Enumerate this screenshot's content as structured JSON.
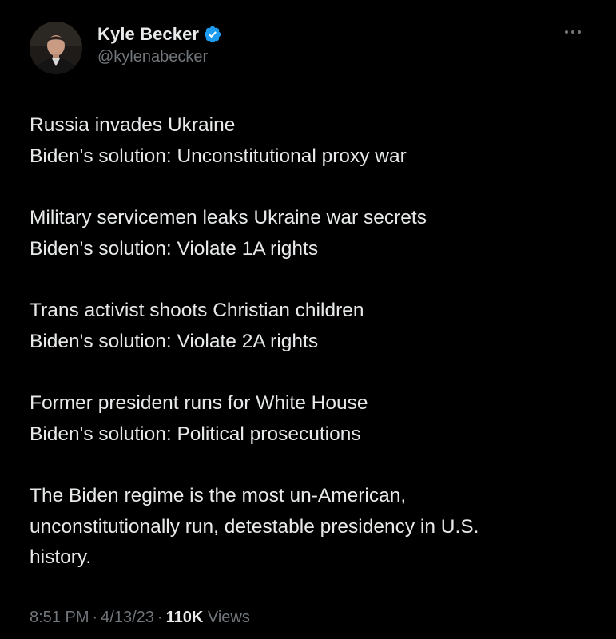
{
  "author": {
    "name": "Kyle Becker",
    "handle": "@kylenabecker",
    "verified_color": "#1d9bf0"
  },
  "paragraphs": [
    [
      "Russia invades Ukraine",
      "Biden's solution: Unconstitutional proxy war"
    ],
    [
      "Military servicemen leaks Ukraine war secrets",
      "Biden's solution: Violate 1A rights"
    ],
    [
      "Trans activist shoots Christian children",
      "Biden's solution: Violate 2A rights"
    ],
    [
      "Former president runs for White House",
      "Biden's solution: Political prosecutions"
    ],
    [
      "The Biden regime is the most un-American,",
      "unconstitutionally run, detestable presidency in U.S.",
      "history."
    ]
  ],
  "meta": {
    "time": "8:51 PM",
    "separator": "·",
    "date": "4/13/23",
    "views_count": "110K",
    "views_label": "Views"
  },
  "icons": {
    "verified": "verified-badge-icon",
    "more": "more-options-icon"
  }
}
